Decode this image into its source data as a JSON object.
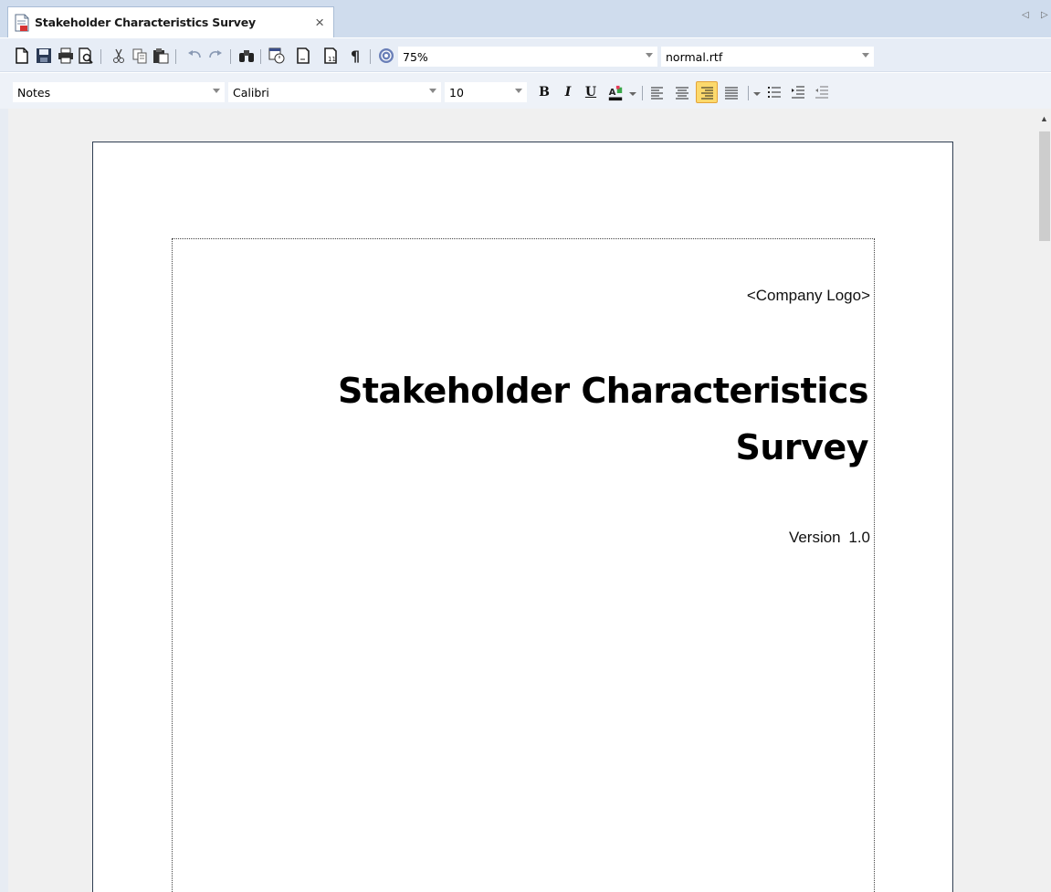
{
  "tab": {
    "title": "Stakeholder Characteristics Survey",
    "close_glyph": "×",
    "nav_left": "◁",
    "nav_right": "▷"
  },
  "toolbar": {
    "zoom": "75%",
    "template": "normal.rtf",
    "icons": [
      "new-document-icon",
      "save-icon",
      "print-icon",
      "print-preview-icon",
      "cut-icon",
      "copy-icon",
      "paste-icon",
      "undo-icon",
      "redo-icon",
      "find-icon",
      "insert-date-icon",
      "page-icon",
      "page-number-icon",
      "paragraph-mark-icon",
      "help-icon"
    ]
  },
  "format": {
    "style": "Notes",
    "font": "Calibri",
    "size": "10",
    "bold": "B",
    "italic": "I",
    "underline": "U",
    "active_alignment": "right",
    "active_color": "#fcd96c"
  },
  "document": {
    "company_logo": "<Company Logo>",
    "title": "Stakeholder Characteristics Survey",
    "version": "Version 1.0"
  }
}
